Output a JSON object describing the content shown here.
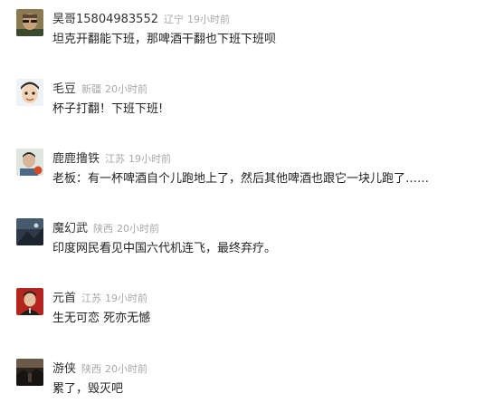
{
  "comments": [
    {
      "username": "昊哥15804983552",
      "region": "辽宁",
      "time": "19小时前",
      "text": "坦克开翻能下班，那啤酒干翻也下班下班呗",
      "avatar": {
        "icon": "sunglasses-man-avatar",
        "bg": "#8a7a52"
      }
    },
    {
      "username": "毛豆",
      "region": "新疆",
      "time": "20小时前",
      "text": "杯子打翻！下班下班!",
      "avatar": {
        "icon": "cartoon-boy-avatar",
        "bg": "#eef3f7"
      }
    },
    {
      "username": "鹿鹿撸铁",
      "region": "江苏",
      "time": "19小时前",
      "text": "老板：有一杯啤酒自个儿跑地上了，然后其他啤酒也跟它一块儿跑了……",
      "avatar": {
        "icon": "portrait-badge-avatar",
        "bg": "#dfe6e0"
      }
    },
    {
      "username": "魔幻武",
      "region": "陕西",
      "time": "20小时前",
      "text": "印度网民看见中国六代机连飞，最终弃疗。",
      "avatar": {
        "icon": "dark-scene-avatar",
        "bg": "#2e3a48"
      }
    },
    {
      "username": "元首",
      "region": "江苏",
      "time": "19小时前",
      "text": "生无可恋 死亦无憾",
      "avatar": {
        "icon": "red-portrait-avatar",
        "bg": "#b32620"
      }
    },
    {
      "username": "游侠",
      "region": "陕西",
      "time": "20小时前",
      "text": "累了，毁灭吧",
      "avatar": {
        "icon": "dark-landscape-avatar",
        "bg": "#2a241e"
      }
    }
  ]
}
